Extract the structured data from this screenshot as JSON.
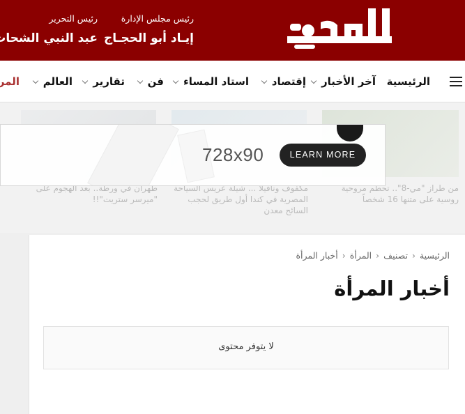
{
  "header": {
    "logo_text": "المساء",
    "board_chair_role": "رئيس مجلس الإدارة",
    "board_chair_name": "إيـاد أبو الحجـاج",
    "editor_role": "رئيس التحرير",
    "editor_name": "عبد النبي الشحات",
    "brand_color": "#8b0000"
  },
  "nav": {
    "menu_icon": "hamburger-icon",
    "items": [
      {
        "label": "الرئيسية"
      },
      {
        "label": "آخر الأخبار"
      },
      {
        "label": "إقتصاد"
      },
      {
        "label": "استاد المساء"
      },
      {
        "label": "فن"
      },
      {
        "label": "تقارير"
      },
      {
        "label": "العالم"
      },
      {
        "label": "المر"
      }
    ]
  },
  "related": {
    "captions": [
      "طهران في ورطة.. بعد الهجوم على \"ميرسر ستريت\"!!",
      "مكفوف ونافيلا ... شيلة عريس السياحة المصرية في كندا أول طريق لحجب السائح معدن",
      "من طراز \"مي-8\".. تحطم مروحية روسية على متنها 16 شخصاً"
    ]
  },
  "ad": {
    "size_label": "728x90",
    "button_label": "LEARN MORE"
  },
  "breadcrumb": {
    "home": "الرئيسية",
    "category": "تصنيف",
    "section": "المرأة",
    "current": "أخبار المرأة",
    "separator": "‹"
  },
  "page": {
    "title": "أخبار المرأة",
    "empty_message": "لا يتوفر محتوى"
  }
}
